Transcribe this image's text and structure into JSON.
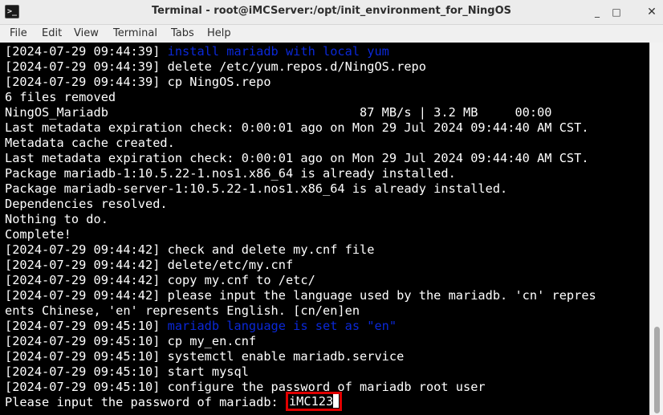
{
  "window": {
    "title": "Terminal - root@iMCServer:/opt/init_environment_for_NingOS",
    "app_icon_glyph": ">_",
    "controls": {
      "minimize": "_",
      "maximize": "□",
      "close": "✕"
    }
  },
  "menu": [
    "File",
    "Edit",
    "View",
    "Terminal",
    "Tabs",
    "Help"
  ],
  "colors": {
    "terminal_bg": "#000000",
    "text": "#ffffff",
    "highlight_blue": "#0a28d8",
    "annotation_red": "#e00000"
  },
  "terminal": {
    "lines": [
      {
        "prefix": "[2024-07-29 09:44:39] ",
        "text": "install mariadb with local yum",
        "blue": true
      },
      {
        "prefix": "[2024-07-29 09:44:39] ",
        "text": "delete /etc/yum.repos.d/NingOS.repo",
        "blue": false
      },
      {
        "prefix": "[2024-07-29 09:44:39] ",
        "text": "cp NingOS.repo",
        "blue": false
      },
      {
        "prefix": "",
        "text": "6 files removed",
        "blue": false
      },
      {
        "prefix": "",
        "text": "NingOS_Mariadb                                  87 MB/s | 3.2 MB     00:00",
        "blue": false
      },
      {
        "prefix": "",
        "text": "Last metadata expiration check: 0:00:01 ago on Mon 29 Jul 2024 09:44:40 AM CST.",
        "blue": false
      },
      {
        "prefix": "",
        "text": "Metadata cache created.",
        "blue": false
      },
      {
        "prefix": "",
        "text": "Last metadata expiration check: 0:00:01 ago on Mon 29 Jul 2024 09:44:40 AM CST.",
        "blue": false
      },
      {
        "prefix": "",
        "text": "Package mariadb-1:10.5.22-1.nos1.x86_64 is already installed.",
        "blue": false
      },
      {
        "prefix": "",
        "text": "Package mariadb-server-1:10.5.22-1.nos1.x86_64 is already installed.",
        "blue": false
      },
      {
        "prefix": "",
        "text": "Dependencies resolved.",
        "blue": false
      },
      {
        "prefix": "",
        "text": "Nothing to do.",
        "blue": false
      },
      {
        "prefix": "",
        "text": "Complete!",
        "blue": false
      },
      {
        "prefix": "[2024-07-29 09:44:42] ",
        "text": "check and delete my.cnf file",
        "blue": false
      },
      {
        "prefix": "[2024-07-29 09:44:42] ",
        "text": "delete/etc/my.cnf",
        "blue": false
      },
      {
        "prefix": "[2024-07-29 09:44:42] ",
        "text": "copy my.cnf to /etc/",
        "blue": false
      },
      {
        "prefix": "[2024-07-29 09:44:42] ",
        "text": "please input the language used by the mariadb. 'cn' repres",
        "blue": false
      },
      {
        "prefix": "",
        "text": "ents Chinese, 'en' represents English. [cn/en]en",
        "blue": false
      },
      {
        "prefix": "[2024-07-29 09:45:10] ",
        "text": "mariadb language is set as \"en\"",
        "blue": true
      },
      {
        "prefix": "[2024-07-29 09:45:10] ",
        "text": "cp my_en.cnf",
        "blue": false
      },
      {
        "prefix": "[2024-07-29 09:45:10] ",
        "text": "systemctl enable mariadb.service",
        "blue": false
      },
      {
        "prefix": "[2024-07-29 09:45:10] ",
        "text": "start mysql",
        "blue": false
      },
      {
        "prefix": "[2024-07-29 09:45:10] ",
        "text": "configure the password of mariadb root user",
        "blue": false
      }
    ],
    "prompt": {
      "label": "Please input the password of mariadb: ",
      "value": "iMC123"
    }
  }
}
